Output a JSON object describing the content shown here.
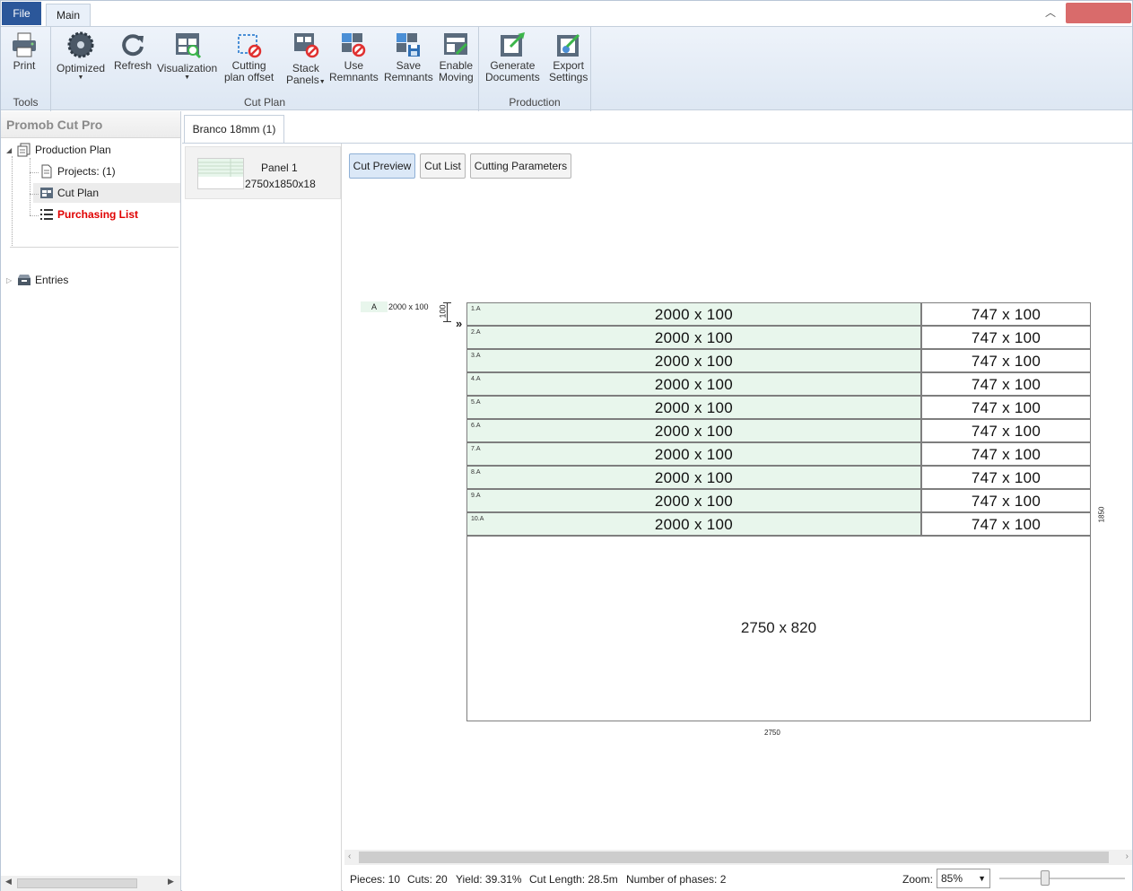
{
  "ribbon": {
    "file_tab": "File",
    "main_tab": "Main",
    "groups": {
      "tools": "Tools",
      "cut_plan": "Cut Plan",
      "production": "Production"
    },
    "buttons": {
      "print": "Print",
      "optimized": "Optimized",
      "refresh": "Refresh",
      "visualization": "Visualization",
      "cutting_offset_1": "Cutting",
      "cutting_offset_2": "plan offset",
      "stack_1": "Stack",
      "stack_2": "Panels",
      "use_rem_1": "Use",
      "use_rem_2": "Remnants",
      "save_rem_1": "Save",
      "save_rem_2": "Remnants",
      "enable_1": "Enable",
      "enable_2": "Moving",
      "gen_1": "Generate",
      "gen_2": "Documents",
      "exp_1": "Export",
      "exp_2": "Settings"
    }
  },
  "sidebar": {
    "title": "Promob Cut Pro",
    "production_plan": "Production Plan",
    "projects": "Projects: (1)",
    "cut_plan": "Cut Plan",
    "purchasing_list": "Purchasing List",
    "entries": "Entries"
  },
  "document": {
    "tab": "Branco 18mm (1)",
    "panel_name": "Panel 1",
    "panel_size": "2750x1850x18",
    "view_buttons": {
      "cut_preview": "Cut Preview",
      "cut_list": "Cut List",
      "cutting_parameters": "Cutting Parameters"
    }
  },
  "preview": {
    "phase_tag": "A",
    "phase_dim": "2000 x 100",
    "strip_height_label": "100",
    "phase_arrow": "»",
    "strips": [
      {
        "label": "1.A",
        "main": "2000 x 100",
        "side": "747 x 100"
      },
      {
        "label": "2.A",
        "main": "2000 x 100",
        "side": "747 x 100"
      },
      {
        "label": "3.A",
        "main": "2000 x 100",
        "side": "747 x 100"
      },
      {
        "label": "4.A",
        "main": "2000 x 100",
        "side": "747 x 100"
      },
      {
        "label": "5.A",
        "main": "2000 x 100",
        "side": "747 x 100"
      },
      {
        "label": "6.A",
        "main": "2000 x 100",
        "side": "747 x 100"
      },
      {
        "label": "7.A",
        "main": "2000 x 100",
        "side": "747 x 100"
      },
      {
        "label": "8.A",
        "main": "2000 x 100",
        "side": "747 x 100"
      },
      {
        "label": "9.A",
        "main": "2000 x 100",
        "side": "747 x 100"
      },
      {
        "label": "10.A",
        "main": "2000 x 100",
        "side": "747 x 100"
      }
    ],
    "waste": "2750 x 820",
    "width_label": "2750",
    "height_label": "1850"
  },
  "status": {
    "pieces": "Pieces: 10",
    "cuts": "Cuts: 20",
    "yield": "Yield: 39.31%",
    "cut_length": "Cut Length: 28.5m",
    "phases": "Number of phases: 2",
    "zoom_label": "Zoom:",
    "zoom_value": "85%"
  },
  "colors": {
    "file_tab": "#2b579a",
    "close_button": "#d96b6b",
    "piece_fill": "#e8f6ec",
    "purchasing_list": "#e00000"
  }
}
